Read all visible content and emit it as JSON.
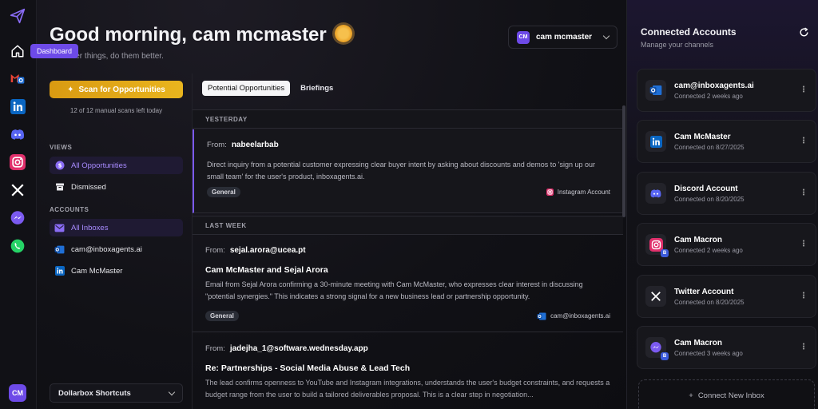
{
  "nav": {
    "tooltip": "Dashboard",
    "avatar_initials": "CM",
    "icons": [
      "paper-plane-logo",
      "home",
      "gmail-outlook",
      "linkedin",
      "discord",
      "instagram",
      "x-twitter",
      "messenger",
      "whatsapp"
    ]
  },
  "header": {
    "greeting": "Good morning, cam mcmaster",
    "subtitle": "Do better things, do them better.",
    "user": {
      "initials": "CM",
      "name": "cam mcmaster"
    }
  },
  "sidebar": {
    "scan_button": "Scan for Opportunities",
    "scan_note": "12 of 12 manual scans left today",
    "views_label": "VIEWS",
    "views": [
      {
        "label": "All Opportunities",
        "active": true
      },
      {
        "label": "Dismissed",
        "active": false
      }
    ],
    "accounts_label": "ACCOUNTS",
    "accounts": [
      {
        "label": "All Inboxes",
        "active": true
      },
      {
        "label": "cam@inboxagents.ai",
        "active": false
      },
      {
        "label": "Cam McMaster",
        "active": false
      }
    ],
    "shortcuts": "Dollarbox Shortcuts"
  },
  "feed": {
    "tabs": [
      "Potential Opportunities",
      "Briefings"
    ],
    "active_tab": 0,
    "from_label": "From:",
    "groups": [
      "YESTERDAY",
      "LAST WEEK"
    ],
    "items": [
      {
        "from": "nabeelarbab",
        "title": "",
        "body": "Direct inquiry from a potential customer expressing clear buyer intent by asking about discounts and demos to 'sign up our small team' for the user's product, inboxagents.ai.",
        "tag": "General",
        "source": "Instagram Account"
      },
      {
        "from": "sejal.arora@ucea.pt",
        "title": "Cam McMaster and Sejal Arora",
        "body": "Email from Sejal Arora confirming a 30-minute meeting with Cam McMaster, who expresses clear interest in discussing \"potential synergies.\" This indicates a strong signal for a new business lead or partnership opportunity.",
        "tag": "General",
        "source": "cam@inboxagents.ai"
      },
      {
        "from": "jadejha_1@software.wednesday.app",
        "title": "Re: Partnerships - Social Media Abuse & Lead Tech",
        "body": "The lead confirms openness to YouTube and Instagram integrations, understands the user's budget constraints, and requests a budget range from the user to build a tailored deliverables proposal. This is a clear step in negotiation...",
        "tag": "",
        "source": ""
      }
    ]
  },
  "connected": {
    "title": "Connected Accounts",
    "subtitle": "Manage your channels",
    "accounts": [
      {
        "name": "cam@inboxagents.ai",
        "meta": "Connected 2 weeks ago",
        "icon": "outlook-icon"
      },
      {
        "name": "Cam McMaster",
        "meta": "Connected on 8/27/2025",
        "icon": "linkedin-icon"
      },
      {
        "name": "Discord Account",
        "meta": "Connected on 8/20/2025",
        "icon": "discord-icon"
      },
      {
        "name": "Cam Macron",
        "meta": "Connected 2 weeks ago",
        "icon": "instagram-icon",
        "badge": "B"
      },
      {
        "name": "Twitter Account",
        "meta": "Connected on 8/20/2025",
        "icon": "x-icon"
      },
      {
        "name": "Cam Macron",
        "meta": "Connected 3 weeks ago",
        "icon": "messenger-icon",
        "badge": "B"
      }
    ],
    "connect_new": "Connect New Inbox"
  },
  "colors": {
    "accent": "#6d4ae8",
    "scan_gold": "#e0a817",
    "background": "#0b0b0f"
  }
}
